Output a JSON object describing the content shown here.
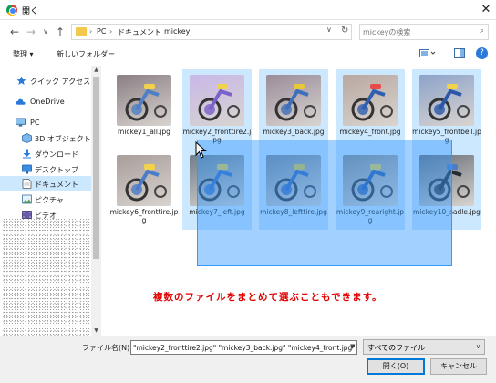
{
  "window": {
    "title": "開く"
  },
  "nav": {
    "back": "←",
    "forward": "→",
    "history": "∨",
    "up": "↑",
    "breadcrumbs": [
      "PC",
      "ドキュメント",
      "mickey"
    ],
    "separator": "›",
    "chevron": "∨",
    "refresh": "↻"
  },
  "search": {
    "placeholder": "mickeyの検索"
  },
  "toolbar": {
    "organize": "整理 ▾",
    "new_folder": "新しいフォルダー"
  },
  "sidebar": {
    "items": [
      {
        "label": "クイック アクセス",
        "icon": "star-icon"
      },
      {
        "label": "OneDrive",
        "icon": "cloud-icon"
      },
      {
        "label": "PC",
        "icon": "computer-icon"
      },
      {
        "label": "3D オブジェクト",
        "icon": "cube-icon"
      },
      {
        "label": "ダウンロード",
        "icon": "download-icon"
      },
      {
        "label": "デスクトップ",
        "icon": "desktop-icon"
      },
      {
        "label": "ドキュメント",
        "icon": "document-icon"
      },
      {
        "label": "ピクチャ",
        "icon": "pictures-icon"
      },
      {
        "label": "ビデオ",
        "icon": "video-icon"
      }
    ]
  },
  "files": [
    {
      "name": "mickey1_all.jpg",
      "selected": false
    },
    {
      "name": "mickey2_fronttire2.jpg",
      "selected": true
    },
    {
      "name": "mickey3_back.jpg",
      "selected": true
    },
    {
      "name": "mickey4_front.jpg",
      "selected": true
    },
    {
      "name": "mickey5_frontbell.jpg",
      "selected": true
    },
    {
      "name": "mickey6_fronttire.jpg",
      "selected": false
    },
    {
      "name": "mickey7_left.jpg",
      "selected": true
    },
    {
      "name": "mickey8_lefttire.jpg",
      "selected": true
    },
    {
      "name": "mickey9_rearight.jpg",
      "selected": true
    },
    {
      "name": "mickey10_sadle.jpg",
      "selected": true
    }
  ],
  "annotation": "複数のファイルをまとめて選ぶこともできます。",
  "footer": {
    "filename_label": "ファイル名(N):",
    "filename_value": "\"mickey2_fronttire2.jpg\" \"mickey3_back.jpg\" \"mickey4_front.jpg\"",
    "filetype": "すべてのファイル",
    "open": "開く(O)",
    "cancel": "キャンセル"
  },
  "colors": {
    "selection": "#cce8ff",
    "marquee": "#3399ff",
    "annotation": "#e00000",
    "accent": "#0078d7"
  }
}
